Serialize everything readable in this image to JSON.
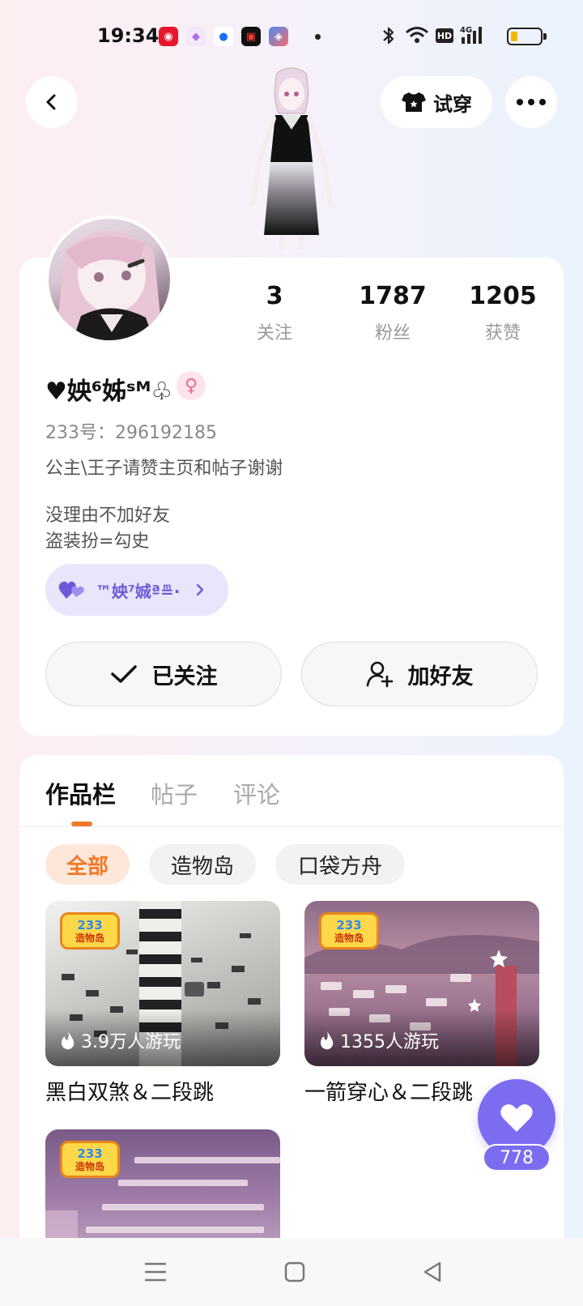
{
  "status_bar": {
    "time": "19:34",
    "battery_level": 0.2,
    "network": "4G",
    "hd": "HD"
  },
  "header": {
    "try_on_label": "试穿"
  },
  "profile": {
    "stats": [
      {
        "value": "3",
        "label": "关注"
      },
      {
        "value": "1787",
        "label": "粉丝"
      },
      {
        "value": "1205",
        "label": "获赞"
      }
    ],
    "nickname": "♥姎⁶姊ˢᴹ♧",
    "gender_symbol": "♀",
    "uid": "233号：296192185",
    "bio_line1": "公主\\王子请赞主页和帖子谢谢",
    "bio_line2": "没理由不加好友",
    "bio_line3": "盗装扮=勾史",
    "guild_name": "™姎⁷娍ª≞·",
    "follow_button": "已关注",
    "add_friend_button": "加好友"
  },
  "tabs": [
    {
      "label": "作品栏",
      "active": true
    },
    {
      "label": "帖子",
      "active": false
    },
    {
      "label": "评论",
      "active": false
    }
  ],
  "filters": [
    {
      "label": "全部",
      "active": true
    },
    {
      "label": "造物岛",
      "active": false
    },
    {
      "label": "口袋方舟",
      "active": false
    }
  ],
  "works": [
    {
      "badge_top": "233",
      "badge_bottom": "造物岛",
      "plays": "3.9万人游玩",
      "title": "黑白双煞＆二段跳"
    },
    {
      "badge_top": "233",
      "badge_bottom": "造物岛",
      "plays": "1355人游玩",
      "title": "一箭穿心＆二段跳"
    },
    {
      "badge_top": "233",
      "badge_bottom": "造物岛",
      "plays": "",
      "title": ""
    }
  ],
  "like_fab": {
    "count": "778"
  },
  "colors": {
    "accent_orange": "#f07a2a",
    "like_purple": "#7b6cf0",
    "guild_purple": "#6d5ad8",
    "gender_pink": "#ee6a8e"
  }
}
